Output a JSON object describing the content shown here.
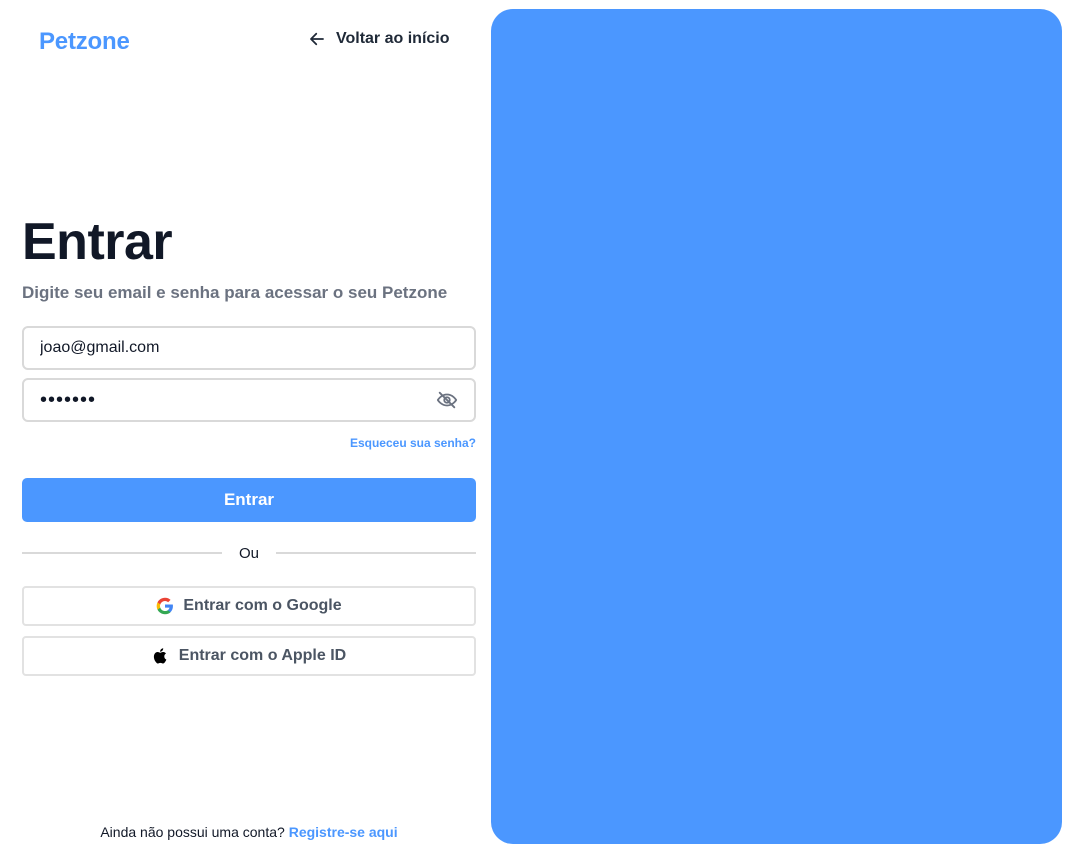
{
  "brand": {
    "name": "Petzone",
    "color": "#4b97ff"
  },
  "header": {
    "back_label": "Voltar ao início",
    "back_icon": "arrow-left-icon"
  },
  "login": {
    "title": "Entrar",
    "subtitle": "Digite seu email e senha para acessar o seu Petzone",
    "email_value": "joao@gmail.com",
    "password_value": "•••••••",
    "password_toggle_icon": "eye-off-icon",
    "forgot_label": "Esqueceu sua senha?",
    "submit_label": "Entrar",
    "divider_label": "Ou",
    "google_label": "Entrar com o Google",
    "google_icon": "google-icon",
    "apple_label": "Entrar com o Apple ID",
    "apple_icon": "apple-icon"
  },
  "footer": {
    "prompt": "Ainda não possui uma conta?",
    "register_label": "Registre-se aqui"
  },
  "colors": {
    "accent": "#4b97ff",
    "panel": "#4b97ff",
    "title": "#111827",
    "muted": "#6b7280",
    "border": "#d9d9d9"
  }
}
